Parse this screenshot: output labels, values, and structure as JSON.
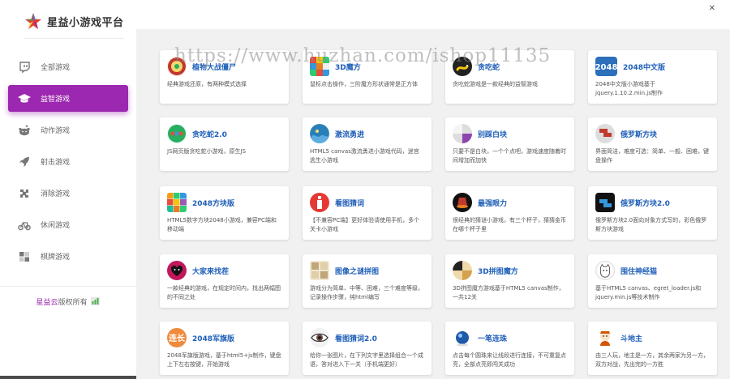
{
  "brand": {
    "name": "星益小游戏平台"
  },
  "topbar": {
    "close_label": "✕"
  },
  "sidebar": {
    "items": [
      {
        "label": "全部游戏",
        "icon": "twitch-icon",
        "active": false
      },
      {
        "label": "益智游戏",
        "icon": "graduation-cap-icon",
        "active": true
      },
      {
        "label": "动作游戏",
        "icon": "reddit-icon",
        "active": false
      },
      {
        "label": "射击游戏",
        "icon": "rocket-icon",
        "active": false
      },
      {
        "label": "消除游戏",
        "icon": "puzzle-icon",
        "active": false
      },
      {
        "label": "休闲游戏",
        "icon": "bike-icon",
        "active": false
      },
      {
        "label": "棋牌游戏",
        "icon": "board-icon",
        "active": false
      }
    ],
    "copyright_link": "星益云",
    "copyright_text": "版权所有"
  },
  "watermark": "https://www.huzhan.com/ishop11135",
  "games": [
    {
      "title": "植物大战僵尸",
      "desc": "经典游戏还原，有两种模式选择",
      "icon": "plants-zombies-icon",
      "color": "#c0392b"
    },
    {
      "title": "3D魔方",
      "desc": "鼠标点击操作，三阶魔方形状通常是正方体",
      "icon": "rubik-cube-icon",
      "color": "#e74c3c"
    },
    {
      "title": "贪吃蛇",
      "desc": "贪吃蛇游戏是一款经典的益智游戏",
      "icon": "snake-icon",
      "color": "#222222"
    },
    {
      "title": "2048中文版",
      "desc": "2048中文版小游戏基于jquery.1.10.2.min.js制作",
      "icon": "2048-icon",
      "color": "#2c6fbb"
    },
    {
      "title": "贪吃蛇2.0",
      "desc": "JS网页版贪吃蛇小游戏，原生JS",
      "icon": "snake2-icon",
      "color": "#27ae60"
    },
    {
      "title": "激流勇进",
      "desc": "HTML5 canvas激流勇进小游戏代码，迷宫逃生小游戏",
      "icon": "rapids-icon",
      "color": "#2980b9"
    },
    {
      "title": "别踩白块",
      "desc": "只要不是白块，一个个点吧，游戏速度随着时间增加而加快",
      "icon": "white-tiles-icon",
      "color": "#8e44ad"
    },
    {
      "title": "俄罗斯方块",
      "desc": "界面简洁，难度可选：简单、一般、困难，键盘操作",
      "icon": "tetris-icon",
      "color": "#c0392b"
    },
    {
      "title": "2048方块版",
      "desc": "HTML5数字方块2048小游戏，兼容PC端和移动端",
      "icon": "blocks-2048-icon",
      "color": "#f39c12"
    },
    {
      "title": "看图猜词",
      "desc": "【不兼容PC端】更好体验请使用手机，多个关卡小游戏",
      "icon": "guess-word-icon",
      "color": "#e53935"
    },
    {
      "title": "最强眼力",
      "desc": "很经典的猜谜小游戏，有三个杯子，猜猜金币在哪个杯子里",
      "icon": "cups-icon",
      "color": "#c0392b"
    },
    {
      "title": "俄罗斯方块2.0",
      "desc": "俄罗斯方块2.0面向对象方式写的，彩色俄罗斯方块游戏",
      "icon": "tetris2-icon",
      "color": "#111111"
    },
    {
      "title": "大家来找茬",
      "desc": "一款经典的游戏，在规定时间内，找出两幅图的不同之处",
      "icon": "spot-difference-icon",
      "color": "#c2185b"
    },
    {
      "title": "图像之谜拼图",
      "desc": "游戏分为简单、中等、困难，三个难度等级，记录操作步骤，纯html编写",
      "icon": "jigsaw-icon",
      "color": "#bfa77a"
    },
    {
      "title": "3D拼图魔方",
      "desc": "3D拼图魔方游戏基于HTML5 canvas制作，一共12关",
      "icon": "3d-puzzle-icon",
      "color": "#d4a24c"
    },
    {
      "title": "围住神经猫",
      "desc": "基于HTML5 canvas、egret_loader.js和jquery.min.js等技术制作",
      "icon": "cat-icon",
      "color": "#666666"
    },
    {
      "title": "2048军旗版",
      "desc": "2048军旗版游戏，基于html5+js制作，键盘上下左右按键，开始游戏",
      "icon": "army-2048-icon",
      "color": "#f08a3c"
    },
    {
      "title": "看图猜词2.0",
      "desc": "给你一张图片，在下列文字里选择组合一个成语，答对进入下一关（手机端更好）",
      "icon": "eye-icon",
      "color": "#333333"
    },
    {
      "title": "一笔连珠",
      "desc": "点击每个圆珠来让线段进行连接，不可重复点亮，全部点亮即闯关成功",
      "icon": "ball-icon",
      "color": "#1e5aa8"
    },
    {
      "title": "斗地主",
      "desc": "由三人玩，地主是一方，其余两家为另一方，双方对战，先出完的一方胜",
      "icon": "landlord-icon",
      "color": "#d35400"
    }
  ]
}
